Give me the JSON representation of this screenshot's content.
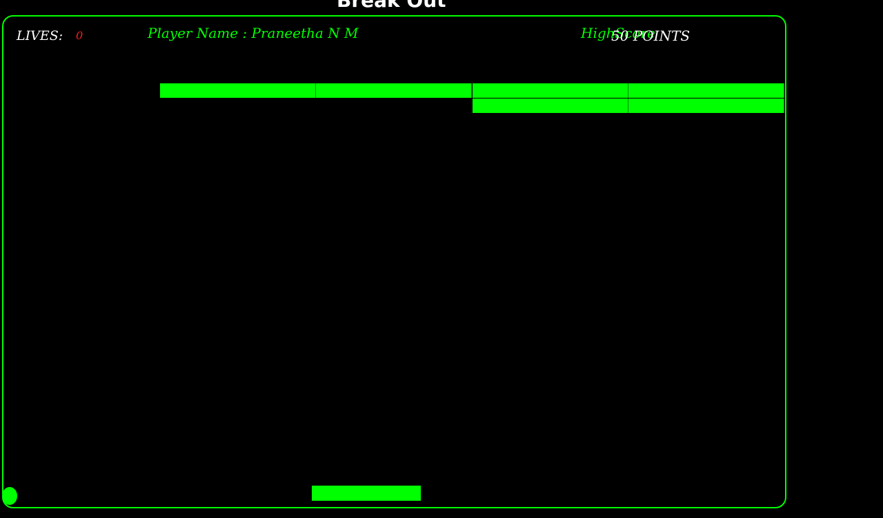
{
  "title": "Break Out",
  "hud": {
    "lives_label": "LIVES:",
    "lives_value": "0",
    "player_name": "Player Name : Praneetha N M",
    "highscore_label": "HighScore",
    "score_value": "50 POINTS"
  },
  "colors": {
    "background": "#000000",
    "accent": "#00ff00",
    "lives_value": "#ff1a1a",
    "text": "#ffffff"
  },
  "bricks": {
    "row_1_count": 4,
    "row_2_count": 2
  }
}
